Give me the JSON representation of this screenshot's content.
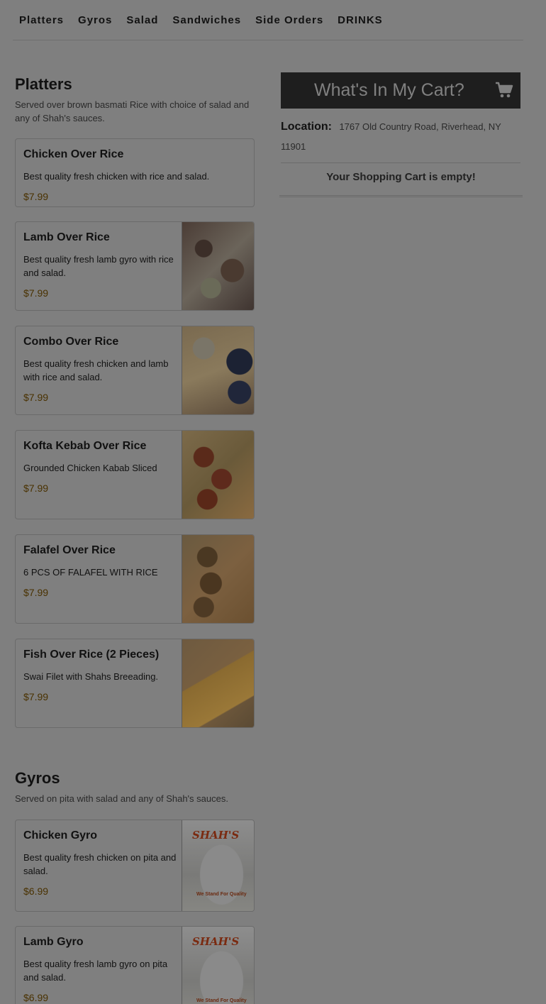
{
  "nav": {
    "items": [
      "Platters",
      "Gyros",
      "Salad",
      "Sandwiches",
      "Side Orders",
      "DRINKS"
    ]
  },
  "platters": {
    "title": "Platters",
    "desc": "Served over brown basmati Rice with choice of salad and any of Shah's sauces.",
    "items": [
      {
        "name": "Chicken Over Rice",
        "desc": "Best quality fresh chicken with rice and salad.",
        "price": "$7.99"
      },
      {
        "name": "Lamb Over Rice",
        "desc": "Best quality fresh lamb gyro with rice and salad.",
        "price": "$7.99"
      },
      {
        "name": "Combo Over Rice",
        "desc": "Best quality fresh chicken and lamb with rice and salad.",
        "price": "$7.99"
      },
      {
        "name": "Kofta Kebab Over Rice",
        "desc": "Grounded Chicken Kabab Sliced",
        "price": "$7.99"
      },
      {
        "name": "Falafel Over Rice",
        "desc": "6 PCS OF FALAFEL WITH RICE",
        "price": "$7.99"
      },
      {
        "name": "Fish Over Rice (2 Pieces)",
        "desc": "Swai Filet with Shahs Breeading.",
        "price": "$7.99"
      }
    ]
  },
  "gyros": {
    "title": "Gyros",
    "desc": "Served on pita with salad and any of Shah's sauces.",
    "logo_text": "SHAH'S",
    "tagline": "We Stand For Quality",
    "items": [
      {
        "name": "Chicken Gyro",
        "desc": "Best quality fresh chicken on pita and salad.",
        "price": "$6.99"
      },
      {
        "name": "Lamb Gyro",
        "desc": "Best quality fresh lamb gyro on pita and salad.",
        "price": "$6.99"
      }
    ]
  },
  "cart": {
    "title": "What's In My Cart?",
    "icon": "shopping-cart-icon",
    "location_label": "Location:",
    "address": "1767 Old Country Road, Riverhead, NY 11901",
    "empty_text": "Your Shopping Cart is empty!"
  }
}
